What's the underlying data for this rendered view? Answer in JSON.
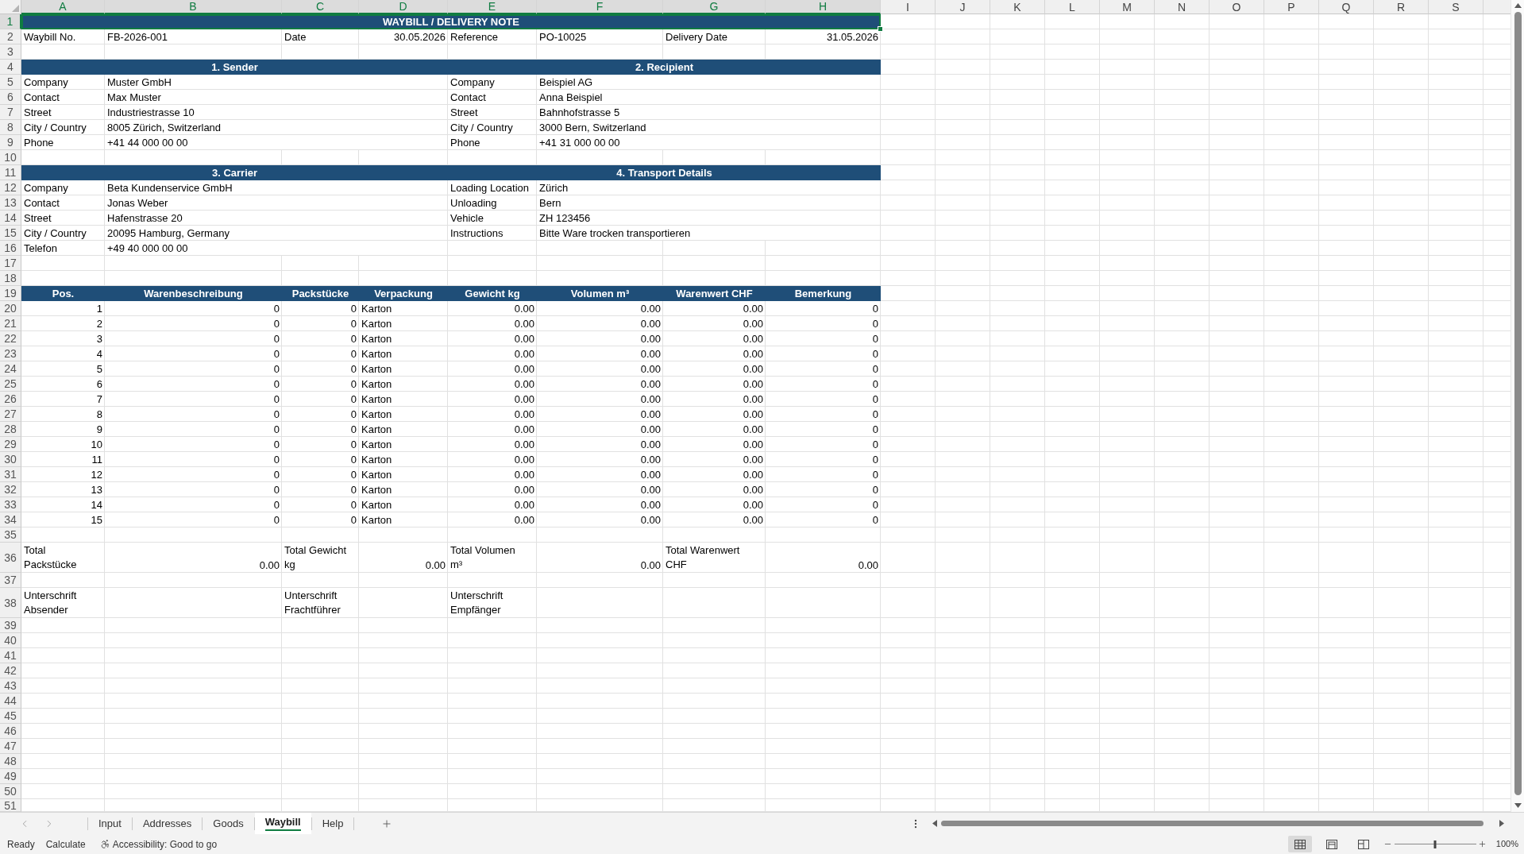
{
  "column_headers": [
    {
      "label": "A",
      "selected": true
    },
    {
      "label": "B",
      "selected": true
    },
    {
      "label": "C",
      "selected": true
    },
    {
      "label": "D",
      "selected": true
    },
    {
      "label": "E",
      "selected": true
    },
    {
      "label": "F",
      "selected": true
    },
    {
      "label": "G",
      "selected": true
    },
    {
      "label": "H",
      "selected": true
    },
    {
      "label": "I",
      "selected": false
    },
    {
      "label": "J",
      "selected": false
    },
    {
      "label": "K",
      "selected": false
    },
    {
      "label": "L",
      "selected": false
    },
    {
      "label": "M",
      "selected": false
    },
    {
      "label": "N",
      "selected": false
    },
    {
      "label": "O",
      "selected": false
    },
    {
      "label": "P",
      "selected": false
    },
    {
      "label": "Q",
      "selected": false
    },
    {
      "label": "R",
      "selected": false
    },
    {
      "label": "S",
      "selected": false
    }
  ],
  "row_headers": [
    {
      "label": "1",
      "selected": true
    },
    {
      "label": "2",
      "selected": false
    },
    {
      "label": "3",
      "selected": false
    },
    {
      "label": "4",
      "selected": false
    },
    {
      "label": "5",
      "selected": false
    },
    {
      "label": "6",
      "selected": false
    },
    {
      "label": "7",
      "selected": false
    },
    {
      "label": "8",
      "selected": false
    },
    {
      "label": "9",
      "selected": false
    },
    {
      "label": "10",
      "selected": false
    },
    {
      "label": "11",
      "selected": false
    },
    {
      "label": "12",
      "selected": false
    },
    {
      "label": "13",
      "selected": false
    },
    {
      "label": "14",
      "selected": false
    },
    {
      "label": "15",
      "selected": false
    },
    {
      "label": "16",
      "selected": false
    },
    {
      "label": "17",
      "selected": false
    },
    {
      "label": "18",
      "selected": false
    },
    {
      "label": "19",
      "selected": false
    },
    {
      "label": "20",
      "selected": false
    },
    {
      "label": "21",
      "selected": false
    },
    {
      "label": "22",
      "selected": false
    },
    {
      "label": "23",
      "selected": false
    },
    {
      "label": "24",
      "selected": false
    },
    {
      "label": "25",
      "selected": false
    },
    {
      "label": "26",
      "selected": false
    },
    {
      "label": "27",
      "selected": false
    },
    {
      "label": "28",
      "selected": false
    },
    {
      "label": "29",
      "selected": false
    },
    {
      "label": "30",
      "selected": false
    },
    {
      "label": "31",
      "selected": false
    },
    {
      "label": "32",
      "selected": false
    },
    {
      "label": "33",
      "selected": false
    },
    {
      "label": "34",
      "selected": false
    },
    {
      "label": "35",
      "selected": false
    },
    {
      "label": "36",
      "selected": false
    },
    {
      "label": "37",
      "selected": false
    },
    {
      "label": "38",
      "selected": false
    },
    {
      "label": "39",
      "selected": false
    },
    {
      "label": "40",
      "selected": false
    },
    {
      "label": "41",
      "selected": false
    },
    {
      "label": "42",
      "selected": false
    },
    {
      "label": "43",
      "selected": false
    },
    {
      "label": "44",
      "selected": false
    },
    {
      "label": "45",
      "selected": false
    },
    {
      "label": "46",
      "selected": false
    },
    {
      "label": "47",
      "selected": false
    },
    {
      "label": "48",
      "selected": false
    },
    {
      "label": "49",
      "selected": false
    },
    {
      "label": "50",
      "selected": false
    },
    {
      "label": "51",
      "selected": false
    }
  ],
  "sheet": {
    "title": {
      "text": "WAYBILL / DELIVERY NOTE",
      "selected": true
    },
    "waybill_info": [
      {
        "label": "Waybill No.",
        "value": "FB-2026-001",
        "kind": "text"
      },
      {
        "label": "Date",
        "value": "30.05.2026",
        "kind": "date"
      },
      {
        "label": "Reference",
        "value": "PO-10025",
        "kind": "text"
      },
      {
        "label": "Delivery Date",
        "value": "31.05.2026",
        "kind": "date"
      }
    ],
    "sections": [
      {
        "title": "1. Sender",
        "fields": [
          {
            "label": "Company",
            "value": "Muster GmbH"
          },
          {
            "label": "Contact",
            "value": "Max Muster"
          },
          {
            "label": "Street",
            "value": "Industriestrasse 10"
          },
          {
            "label": "City / Country",
            "value": "8005 Zürich, Switzerland"
          },
          {
            "label": "Phone",
            "value": "+41 44 000 00 00"
          }
        ]
      },
      {
        "title": "2. Recipient",
        "fields": [
          {
            "label": "Company",
            "value": "Beispiel AG"
          },
          {
            "label": "Contact",
            "value": "Anna Beispiel"
          },
          {
            "label": "Street",
            "value": "Bahnhofstrasse 5"
          },
          {
            "label": "City / Country",
            "value": "3000 Bern, Switzerland"
          },
          {
            "label": "Phone",
            "value": "+41 31 000 00 00"
          }
        ]
      },
      {
        "title": "3. Carrier",
        "fields": [
          {
            "label": "Company",
            "value": "Beta Kundenservice GmbH"
          },
          {
            "label": "Contact",
            "value": "Jonas Weber"
          },
          {
            "label": "Street",
            "value": "Hafenstrasse 20"
          },
          {
            "label": "City / Country",
            "value": "20095 Hamburg, Germany"
          },
          {
            "label": "Telefon",
            "value": "+49 40 000 00 00"
          }
        ]
      },
      {
        "title": "4. Transport Details",
        "fields": [
          {
            "label": "Loading Location",
            "value": "Zürich"
          },
          {
            "label": "Unloading",
            "value": "Bern"
          },
          {
            "label": "Vehicle",
            "value": "ZH 123456"
          },
          {
            "label": "Instructions",
            "value": "Bitte Ware trocken transportieren"
          }
        ]
      }
    ],
    "items_table": {
      "columns": [
        {
          "label": "Pos.",
          "kind": "number"
        },
        {
          "label": "Warenbeschreibung",
          "kind": "number"
        },
        {
          "label": "Packstücke",
          "kind": "number"
        },
        {
          "label": "Verpackung",
          "kind": "text"
        },
        {
          "label": "Gewicht kg",
          "kind": "number"
        },
        {
          "label": "Volumen m³",
          "kind": "number"
        },
        {
          "label": "Warenwert CHF",
          "kind": "number"
        },
        {
          "label": "Bemerkung",
          "kind": "number"
        }
      ],
      "rows": [
        [
          "1",
          "0",
          "0",
          "Karton",
          "0.00",
          "0.00",
          "0.00",
          "0"
        ],
        [
          "2",
          "0",
          "0",
          "Karton",
          "0.00",
          "0.00",
          "0.00",
          "0"
        ],
        [
          "3",
          "0",
          "0",
          "Karton",
          "0.00",
          "0.00",
          "0.00",
          "0"
        ],
        [
          "4",
          "0",
          "0",
          "Karton",
          "0.00",
          "0.00",
          "0.00",
          "0"
        ],
        [
          "5",
          "0",
          "0",
          "Karton",
          "0.00",
          "0.00",
          "0.00",
          "0"
        ],
        [
          "6",
          "0",
          "0",
          "Karton",
          "0.00",
          "0.00",
          "0.00",
          "0"
        ],
        [
          "7",
          "0",
          "0",
          "Karton",
          "0.00",
          "0.00",
          "0.00",
          "0"
        ],
        [
          "8",
          "0",
          "0",
          "Karton",
          "0.00",
          "0.00",
          "0.00",
          "0"
        ],
        [
          "9",
          "0",
          "0",
          "Karton",
          "0.00",
          "0.00",
          "0.00",
          "0"
        ],
        [
          "10",
          "0",
          "0",
          "Karton",
          "0.00",
          "0.00",
          "0.00",
          "0"
        ],
        [
          "11",
          "0",
          "0",
          "Karton",
          "0.00",
          "0.00",
          "0.00",
          "0"
        ],
        [
          "12",
          "0",
          "0",
          "Karton",
          "0.00",
          "0.00",
          "0.00",
          "0"
        ],
        [
          "13",
          "0",
          "0",
          "Karton",
          "0.00",
          "0.00",
          "0.00",
          "0"
        ],
        [
          "14",
          "0",
          "0",
          "Karton",
          "0.00",
          "0.00",
          "0.00",
          "0"
        ],
        [
          "15",
          "0",
          "0",
          "Karton",
          "0.00",
          "0.00",
          "0.00",
          "0"
        ]
      ]
    },
    "totals": [
      {
        "label": "Total\nPackstücke",
        "value": "0.00"
      },
      {
        "label": "Total Gewicht\nkg",
        "value": "0.00"
      },
      {
        "label": "Total Volumen\nm³",
        "value": "0.00"
      },
      {
        "label": "Total Warenwert\nCHF",
        "value": "0.00"
      }
    ],
    "signatures": [
      "Unterschrift\nAbsender",
      "Unterschrift\nFrachtführer",
      "Unterschrift\nEmpfänger"
    ]
  },
  "sheet_tabs": [
    {
      "label": "Input",
      "selected": false
    },
    {
      "label": "Addresses",
      "selected": false
    },
    {
      "label": "Goods",
      "selected": false
    },
    {
      "label": "Waybill",
      "selected": true
    },
    {
      "label": "Help",
      "selected": false
    }
  ],
  "status_bar": {
    "mode": "Ready",
    "calculate": "Calculate",
    "accessibility": "Accessibility: Good to go",
    "view_buttons": [
      {
        "kind": "normal",
        "selected": true
      },
      {
        "kind": "page-layout",
        "selected": false
      },
      {
        "kind": "page-break-preview",
        "selected": false
      }
    ],
    "zoom": {
      "level": 0.5,
      "reading": "100%"
    }
  }
}
